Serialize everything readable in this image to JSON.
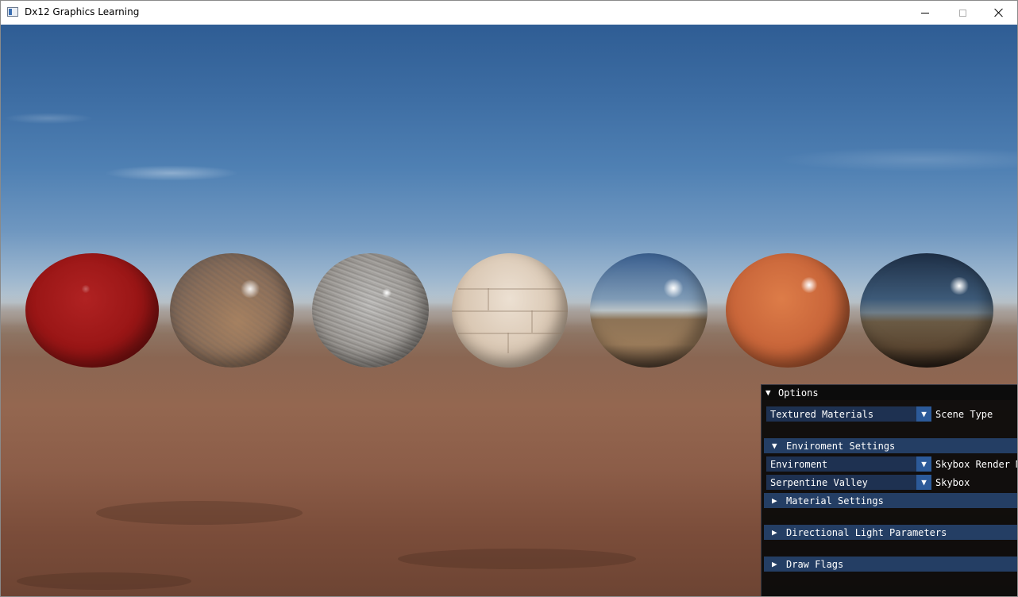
{
  "window": {
    "title": "Dx12 Graphics Learning",
    "controls": {
      "minimize": "minimize-icon",
      "maximize": "maximize-icon",
      "close": "close-icon"
    }
  },
  "scene": {
    "skybox": "Serpentine Valley",
    "spheres": [
      {
        "material": "red-plastic",
        "color": "#9a1616"
      },
      {
        "material": "rusted-metal",
        "color": "#7f7268"
      },
      {
        "material": "granite",
        "color": "#a9a6a2"
      },
      {
        "material": "white-brick",
        "color": "#dac8b4"
      },
      {
        "material": "chrome",
        "color": "#8a8f94"
      },
      {
        "material": "orange-plastic",
        "color": "#c9663a"
      },
      {
        "material": "dark-metal",
        "color": "#3d4a56"
      }
    ]
  },
  "options": {
    "title": "Options",
    "scene_type": {
      "value": "Textured Materials",
      "label": "Scene Type"
    },
    "environment": {
      "header": "Enviroment Settings",
      "render_mode": {
        "value": "Enviroment",
        "label": "Skybox Render M"
      },
      "skybox": {
        "value": "Serpentine Valley",
        "label": "Skybox"
      }
    },
    "sections": {
      "material": "Material Settings",
      "directional_light": "Directional Light Parameters",
      "draw_flags": "Draw Flags"
    },
    "glyphs": {
      "expanded": "▼",
      "collapsed": "▶",
      "dropdown": "▼"
    }
  },
  "colors": {
    "imgui_panel_bg": "#0a0a0a",
    "imgui_combo_bg": "#1e3151",
    "imgui_combo_button": "#2c5a99",
    "imgui_header_bg": "#243e64"
  }
}
